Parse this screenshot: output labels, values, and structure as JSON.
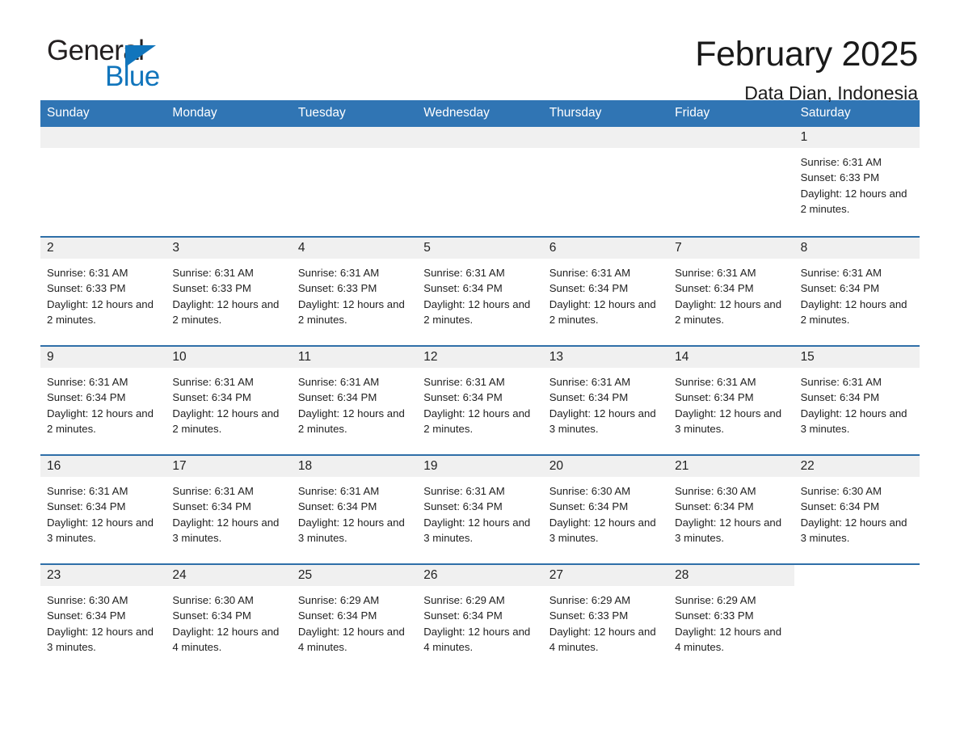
{
  "logo": {
    "word_one": "General",
    "word_two": "Blue",
    "triangle_icon": "triangle-icon"
  },
  "header": {
    "title": "February 2025",
    "subtitle": "Data Dian, Indonesia"
  },
  "colors": {
    "header_blue": "#3075b4",
    "row_border_blue": "#2f6fa8",
    "daynum_band": "#f0f0f0",
    "logo_blue": "#1175bc",
    "text": "#1a1a1a"
  },
  "weekdays": [
    "Sunday",
    "Monday",
    "Tuesday",
    "Wednesday",
    "Thursday",
    "Friday",
    "Saturday"
  ],
  "labels": {
    "sunrise_prefix": "Sunrise:",
    "sunset_prefix": "Sunset:",
    "daylight_prefix": "Daylight:"
  },
  "weeks": [
    [
      {
        "day": "",
        "empty": true
      },
      {
        "day": "",
        "empty": true
      },
      {
        "day": "",
        "empty": true
      },
      {
        "day": "",
        "empty": true
      },
      {
        "day": "",
        "empty": true
      },
      {
        "day": "",
        "empty": true
      },
      {
        "day": "1",
        "sunrise": "Sunrise: 6:31 AM",
        "sunset": "Sunset: 6:33 PM",
        "daylight": "Daylight: 12 hours and 2 minutes."
      }
    ],
    [
      {
        "day": "2",
        "sunrise": "Sunrise: 6:31 AM",
        "sunset": "Sunset: 6:33 PM",
        "daylight": "Daylight: 12 hours and 2 minutes."
      },
      {
        "day": "3",
        "sunrise": "Sunrise: 6:31 AM",
        "sunset": "Sunset: 6:33 PM",
        "daylight": "Daylight: 12 hours and 2 minutes."
      },
      {
        "day": "4",
        "sunrise": "Sunrise: 6:31 AM",
        "sunset": "Sunset: 6:33 PM",
        "daylight": "Daylight: 12 hours and 2 minutes."
      },
      {
        "day": "5",
        "sunrise": "Sunrise: 6:31 AM",
        "sunset": "Sunset: 6:34 PM",
        "daylight": "Daylight: 12 hours and 2 minutes."
      },
      {
        "day": "6",
        "sunrise": "Sunrise: 6:31 AM",
        "sunset": "Sunset: 6:34 PM",
        "daylight": "Daylight: 12 hours and 2 minutes."
      },
      {
        "day": "7",
        "sunrise": "Sunrise: 6:31 AM",
        "sunset": "Sunset: 6:34 PM",
        "daylight": "Daylight: 12 hours and 2 minutes."
      },
      {
        "day": "8",
        "sunrise": "Sunrise: 6:31 AM",
        "sunset": "Sunset: 6:34 PM",
        "daylight": "Daylight: 12 hours and 2 minutes."
      }
    ],
    [
      {
        "day": "9",
        "sunrise": "Sunrise: 6:31 AM",
        "sunset": "Sunset: 6:34 PM",
        "daylight": "Daylight: 12 hours and 2 minutes."
      },
      {
        "day": "10",
        "sunrise": "Sunrise: 6:31 AM",
        "sunset": "Sunset: 6:34 PM",
        "daylight": "Daylight: 12 hours and 2 minutes."
      },
      {
        "day": "11",
        "sunrise": "Sunrise: 6:31 AM",
        "sunset": "Sunset: 6:34 PM",
        "daylight": "Daylight: 12 hours and 2 minutes."
      },
      {
        "day": "12",
        "sunrise": "Sunrise: 6:31 AM",
        "sunset": "Sunset: 6:34 PM",
        "daylight": "Daylight: 12 hours and 2 minutes."
      },
      {
        "day": "13",
        "sunrise": "Sunrise: 6:31 AM",
        "sunset": "Sunset: 6:34 PM",
        "daylight": "Daylight: 12 hours and 3 minutes."
      },
      {
        "day": "14",
        "sunrise": "Sunrise: 6:31 AM",
        "sunset": "Sunset: 6:34 PM",
        "daylight": "Daylight: 12 hours and 3 minutes."
      },
      {
        "day": "15",
        "sunrise": "Sunrise: 6:31 AM",
        "sunset": "Sunset: 6:34 PM",
        "daylight": "Daylight: 12 hours and 3 minutes."
      }
    ],
    [
      {
        "day": "16",
        "sunrise": "Sunrise: 6:31 AM",
        "sunset": "Sunset: 6:34 PM",
        "daylight": "Daylight: 12 hours and 3 minutes."
      },
      {
        "day": "17",
        "sunrise": "Sunrise: 6:31 AM",
        "sunset": "Sunset: 6:34 PM",
        "daylight": "Daylight: 12 hours and 3 minutes."
      },
      {
        "day": "18",
        "sunrise": "Sunrise: 6:31 AM",
        "sunset": "Sunset: 6:34 PM",
        "daylight": "Daylight: 12 hours and 3 minutes."
      },
      {
        "day": "19",
        "sunrise": "Sunrise: 6:31 AM",
        "sunset": "Sunset: 6:34 PM",
        "daylight": "Daylight: 12 hours and 3 minutes."
      },
      {
        "day": "20",
        "sunrise": "Sunrise: 6:30 AM",
        "sunset": "Sunset: 6:34 PM",
        "daylight": "Daylight: 12 hours and 3 minutes."
      },
      {
        "day": "21",
        "sunrise": "Sunrise: 6:30 AM",
        "sunset": "Sunset: 6:34 PM",
        "daylight": "Daylight: 12 hours and 3 minutes."
      },
      {
        "day": "22",
        "sunrise": "Sunrise: 6:30 AM",
        "sunset": "Sunset: 6:34 PM",
        "daylight": "Daylight: 12 hours and 3 minutes."
      }
    ],
    [
      {
        "day": "23",
        "sunrise": "Sunrise: 6:30 AM",
        "sunset": "Sunset: 6:34 PM",
        "daylight": "Daylight: 12 hours and 3 minutes."
      },
      {
        "day": "24",
        "sunrise": "Sunrise: 6:30 AM",
        "sunset": "Sunset: 6:34 PM",
        "daylight": "Daylight: 12 hours and 4 minutes."
      },
      {
        "day": "25",
        "sunrise": "Sunrise: 6:29 AM",
        "sunset": "Sunset: 6:34 PM",
        "daylight": "Daylight: 12 hours and 4 minutes."
      },
      {
        "day": "26",
        "sunrise": "Sunrise: 6:29 AM",
        "sunset": "Sunset: 6:34 PM",
        "daylight": "Daylight: 12 hours and 4 minutes."
      },
      {
        "day": "27",
        "sunrise": "Sunrise: 6:29 AM",
        "sunset": "Sunset: 6:33 PM",
        "daylight": "Daylight: 12 hours and 4 minutes."
      },
      {
        "day": "28",
        "sunrise": "Sunrise: 6:29 AM",
        "sunset": "Sunset: 6:33 PM",
        "daylight": "Daylight: 12 hours and 4 minutes."
      },
      {
        "day": "",
        "empty": true,
        "blank_tail": true
      }
    ]
  ]
}
